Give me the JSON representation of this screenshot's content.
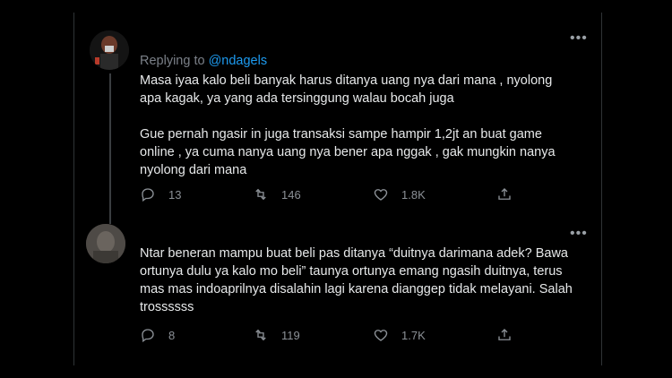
{
  "tweet1": {
    "reply_prefix": "Replying to ",
    "reply_handle": "@ndagels",
    "text": "Masa iyaa kalo beli banyak harus ditanya uang nya dari mana , nyolong\napa kagak, ya yang ada tersinggung walau bocah juga\n\nGue pernah ngasir in juga transaksi sampe hampir 1,2jt an buat game\nonline , ya cuma nanya uang nya bener apa nggak , gak mungkin nanya\nnyolong dari mana",
    "replies": "13",
    "retweets": "146",
    "likes": "1.8K",
    "more": "•••"
  },
  "tweet2": {
    "text": "Ntar beneran mampu buat beli pas ditanya “duitnya darimana adek? Bawa\nortunya dulu ya kalo mo beli” taunya ortunya emang ngasih duitnya, terus\nmas mas indoaprilnya disalahin lagi karena dianggep tidak melayani. Salah\ntrossssss",
    "replies": "8",
    "retweets": "119",
    "likes": "1.7K",
    "more": "•••"
  },
  "icons": {
    "reply": "reply-icon",
    "retweet": "retweet-icon",
    "like": "heart-icon",
    "share": "share-icon",
    "more": "more-icon"
  }
}
